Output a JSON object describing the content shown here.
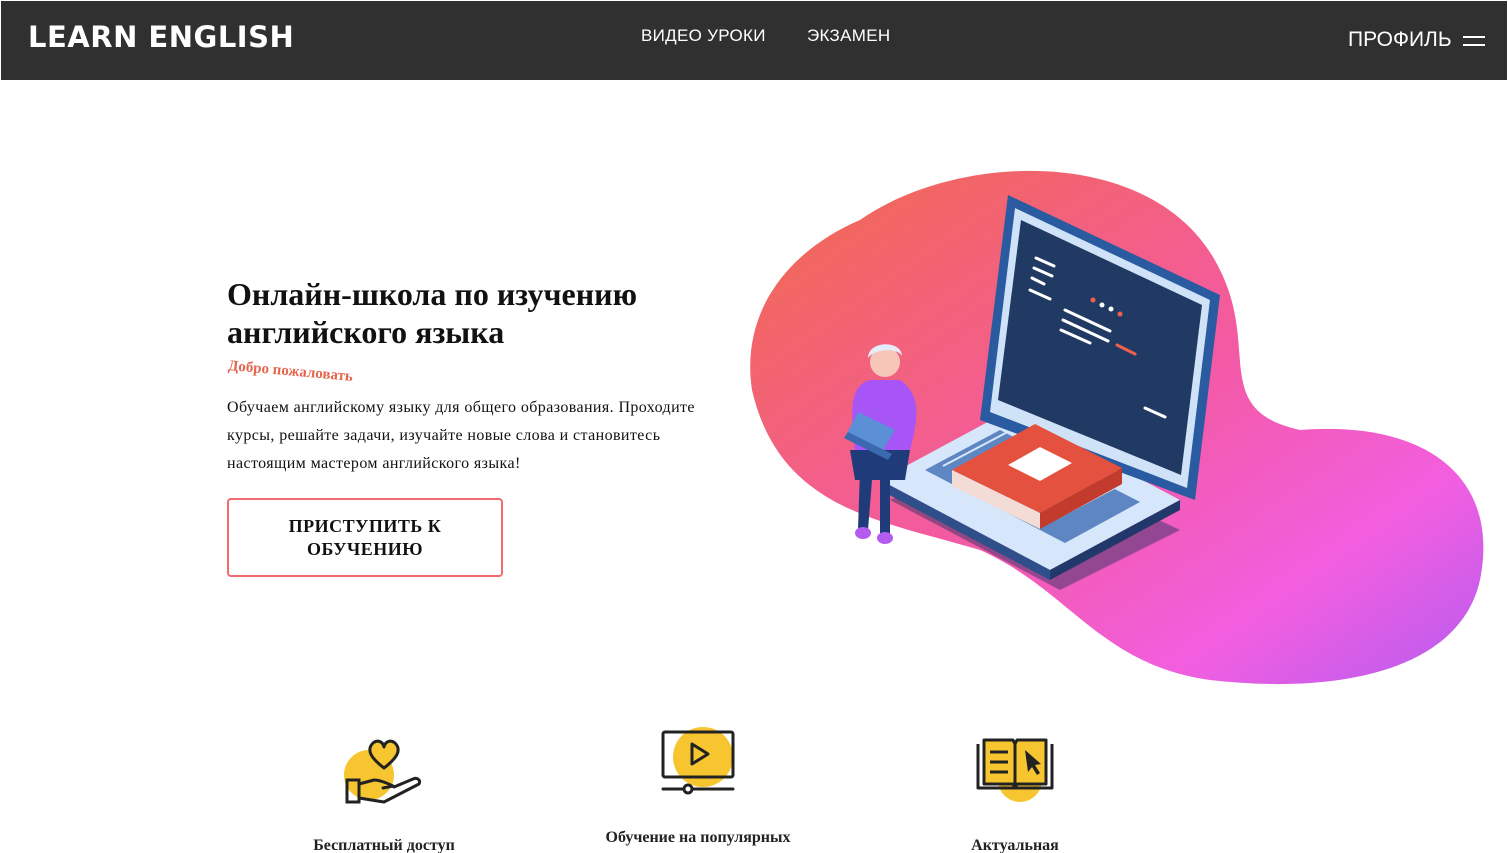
{
  "nav": {
    "logo": "LEARN ENGLISH",
    "links": [
      "ВИДЕО УРОКИ",
      "ЭКЗАМЕН"
    ],
    "profile": "ПРОФИЛЬ",
    "icons": {
      "menu": "hamburger-menu-icon"
    }
  },
  "hero": {
    "title": "Онлайн-школа по изучению английского языка",
    "subtitle": "Добро пожаловать",
    "description": "Обучаем английскому языку для общего образования. Проходите курсы, решайте задачи, изучайте новые слова и становитесь настоящим мастером английского языка!",
    "cta": "ПРИСТУПИТЬ К ОБУЧЕНИЮ"
  },
  "features": [
    {
      "icon": "heart-hand-icon",
      "label": "Бесплатный доступ"
    },
    {
      "icon": "video-play-icon",
      "label": "Обучение на популярных"
    },
    {
      "icon": "open-book-icon",
      "label": "Актуальная"
    }
  ],
  "colors": {
    "navbar": "#303030",
    "accent": "#e5654f",
    "button_border": "#ef6b6f",
    "icon_yellow": "#f6c52f",
    "blob_start": "#f26a4b",
    "blob_end": "#b45cf0"
  }
}
